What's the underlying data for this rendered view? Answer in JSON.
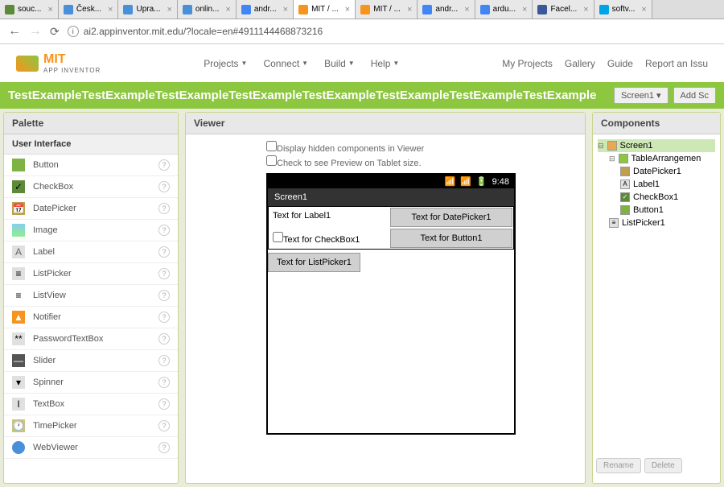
{
  "browser": {
    "tabs": [
      {
        "label": "souc..."
      },
      {
        "label": "Česk..."
      },
      {
        "label": "Upra..."
      },
      {
        "label": "onlin..."
      },
      {
        "label": "andr..."
      },
      {
        "label": "MIT / ...",
        "active": true
      },
      {
        "label": "MIT / ..."
      },
      {
        "label": "andr..."
      },
      {
        "label": "ardu..."
      },
      {
        "label": "Facel..."
      },
      {
        "label": "softv..."
      }
    ],
    "url": "ai2.appinventor.mit.edu/?locale=en#4911144468873216"
  },
  "logo": {
    "main": "MIT",
    "sub": "APP INVENTOR"
  },
  "top_menu": [
    {
      "label": "Projects",
      "has_caret": true
    },
    {
      "label": "Connect",
      "has_caret": true
    },
    {
      "label": "Build",
      "has_caret": true
    },
    {
      "label": "Help",
      "has_caret": true
    }
  ],
  "right_menu": [
    "My Projects",
    "Gallery",
    "Guide",
    "Report an Issu"
  ],
  "project": {
    "name": "TestExampleTestExampleTestExampleTestExampleTestExampleTestExampleTestExampleTestExample",
    "buttons": [
      "Screen1 ▾",
      "Add Sc"
    ]
  },
  "palette": {
    "header": "Palette",
    "sub_header": "User Interface",
    "items": [
      "Button",
      "CheckBox",
      "DatePicker",
      "Image",
      "Label",
      "ListPicker",
      "ListView",
      "Notifier",
      "PasswordTextBox",
      "Slider",
      "Spinner",
      "TextBox",
      "TimePicker",
      "WebViewer"
    ]
  },
  "viewer": {
    "header": "Viewer",
    "check1": "Display hidden components in Viewer",
    "check2": "Check to see Preview on Tablet size.",
    "phone_time": "9:48",
    "phone_title": "Screen1",
    "label1": "Text for Label1",
    "datepicker": "Text for DatePicker1",
    "checkbox1": "Text for CheckBox1",
    "button1": "Text for Button1",
    "listpicker": "Text for ListPicker1"
  },
  "components": {
    "header": "Components",
    "tree": {
      "screen": "Screen1",
      "table": "TableArrangemen",
      "datepicker": "DatePicker1",
      "label": "Label1",
      "checkbox": "CheckBox1",
      "button": "Button1",
      "listpicker": "ListPicker1"
    },
    "buttons": [
      "Rename",
      "Delete"
    ]
  }
}
